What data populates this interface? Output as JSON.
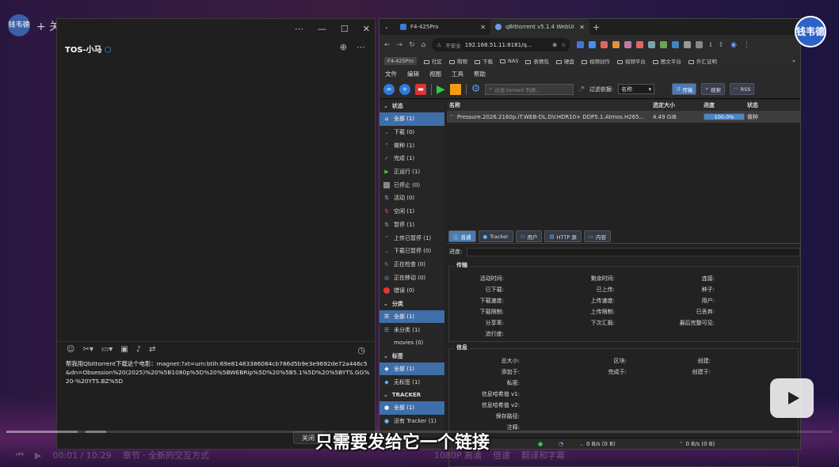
{
  "overlay": {
    "logo_text": "钱韦德",
    "follow": "+ 关注"
  },
  "chat": {
    "title": "TOS-小马",
    "message": "帮我用Qbittorrent下载这个电影：magnet:?xt=urn:btih:69e81483386084cb786d5b9e3e9692de72a446c5&dn=Obsession%20(2025)%20%5B1080p%5D%20%5BWEBRip%5D%20%5B5.1%5D%20%5BYTS.GG%20-%20YTS.BZ%5D",
    "close_label": "关闭"
  },
  "browser": {
    "tabs": [
      {
        "label": "F4-425Pro"
      },
      {
        "label": "qBittorrent v5.1.4 WebUI"
      }
    ],
    "security": "不安全",
    "url": "192.168.51.11:8181/q...",
    "bookmarks": [
      "F4-425Pro",
      "社区",
      "购物",
      "下载",
      "NAS",
      "表情包",
      "硬盘",
      "视频创作",
      "视频平台",
      "图文平台",
      "外汇证明"
    ]
  },
  "qb": {
    "menu": [
      "文件",
      "编辑",
      "视图",
      "工具",
      "帮助"
    ],
    "filter_placeholder": "过滤 torrent 列表...",
    "filter_by_label": "过滤依据:",
    "filter_by_value": "名称",
    "btn_transfer": "传输",
    "btn_search": "搜索",
    "btn_rss": "RSS",
    "sidebar": {
      "status_header": "状态",
      "status_items": [
        "全部 (1)",
        "下载 (0)",
        "做种 (1)",
        "完成 (1)",
        "正运行 (1)",
        "已停止 (0)",
        "活动 (0)",
        "空闲 (1)",
        "暂停 (1)",
        "上传已暂停 (1)",
        "下载已暂停 (0)",
        "正在检查 (0)",
        "正在移动 (0)",
        "错误 (0)"
      ],
      "cat_header": "分类",
      "cat_items": [
        "全部 (1)",
        "未分类 (1)",
        "movies (0)"
      ],
      "tag_header": "标签",
      "tag_items": [
        "全部 (1)",
        "无标签 (1)"
      ],
      "tracker_header": "TRACKER",
      "tracker_items": [
        "全部 (1)",
        "没有 Tracker (1)"
      ]
    },
    "columns": {
      "name": "名称",
      "size": "选定大小",
      "progress": "进度",
      "status": "状态"
    },
    "torrent": {
      "name": "Pressure.2026.2160p.iT.WEB-DL.DV.HDR10+ DDP5.1.Atmos.H265...",
      "size": "4.49 GiB",
      "progress": 1.0,
      "progress_label": "100.0%",
      "status": "做种"
    },
    "detail_tabs": [
      "普通",
      "Tracker",
      "用户",
      "HTTP 源",
      "内容"
    ],
    "progress_label": "进度:",
    "transfer_legend": "传输",
    "transfer_fields": {
      "col1": [
        "活动时间:",
        "已下载:",
        "下载速度:",
        "下载限制:",
        "分享率:",
        "流行度:"
      ],
      "col2": [
        "剩余时间:",
        "已上传:",
        "上传速度:",
        "上传限制:",
        "下次汇报:"
      ],
      "col3": [
        "连接:",
        "种子:",
        "用户:",
        "已丢弃:",
        "最后完整可见:"
      ]
    },
    "info_legend": "信息",
    "info_fields": {
      "col1": [
        "总大小:",
        "添加于:",
        "私密:",
        "信息哈希值 v1:",
        "信息哈希值 v2:",
        "保存路径:",
        "注释:"
      ],
      "col2": [
        "区块:",
        "完成于:"
      ],
      "col3": [
        "创建:",
        "创建于:"
      ]
    },
    "status_dl": "0 B/s (0 B)",
    "status_ul": "0 B/s (0 B)"
  },
  "player": {
    "time": "00:01 / 10:29",
    "chapter": "章节 · 全新的交互方式",
    "quality": "1080P 高清",
    "speed": "倍速",
    "subtitle_btn": "翻译和字幕"
  },
  "subtitle": "只需要发给它一个链接",
  "colors": {
    "accent": "#4a7cb3",
    "seed": "#2d63c8"
  }
}
